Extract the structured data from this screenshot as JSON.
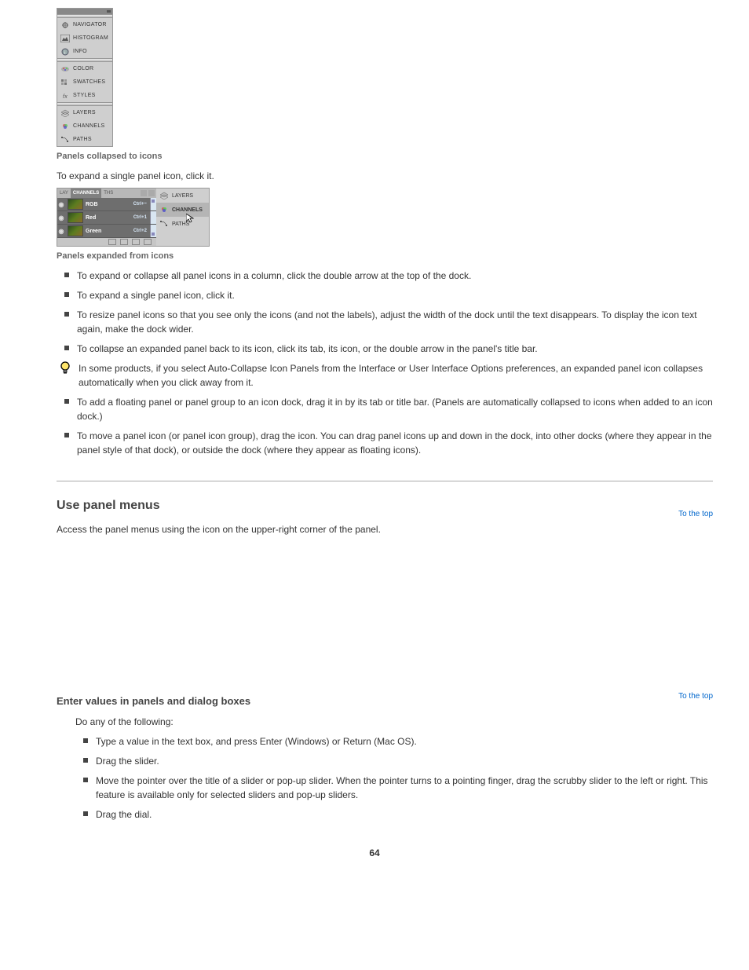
{
  "fig1": {
    "caption_label": "Panels collapsed to icons",
    "items": [
      {
        "label": "NAVIGATOR"
      },
      {
        "label": "HISTOGRAM"
      },
      {
        "label": "INFO"
      },
      {
        "label": "COLOR"
      },
      {
        "label": "SWATCHES"
      },
      {
        "label": "STYLES"
      },
      {
        "label": "LAYERS"
      },
      {
        "label": "CHANNELS"
      },
      {
        "label": "PATHS"
      }
    ]
  },
  "intro_text": "To expand a single panel icon, click it.",
  "fig2": {
    "tabs": {
      "t0": "LAY",
      "t1": "CHANNELS",
      "t2": "THS"
    },
    "channels": [
      {
        "name": "RGB",
        "shortcut": "Ctrl+~"
      },
      {
        "name": "Red",
        "shortcut": "Ctrl+1"
      },
      {
        "name": "Green",
        "shortcut": "Ctrl+2"
      }
    ],
    "right_items": [
      {
        "label": "LAYERS"
      },
      {
        "label": "CHANNELS"
      },
      {
        "label": "PATHS"
      }
    ],
    "caption_label": "Panels expanded from icons"
  },
  "bullets_a": [
    "To expand or collapse all panel icons in a column, click the double arrow at the top of the dock.",
    "To expand a single panel icon, click it.",
    "To resize panel icons so that you see only the icons (and not the labels), adjust the width of the dock until the text disappears. To display the icon text again, make the dock wider.",
    "To collapse an expanded panel back to its icon, click its tab, its icon, or the double arrow in the panel's title bar."
  ],
  "tip_text": "In some products, if you select Auto-Collapse Icon Panels from the Interface or User Interface Options preferences, an expanded panel icon collapses automatically when you click away from it.",
  "bullets_b": [
    "To add a floating panel or panel group to an icon dock, drag it in by its tab or title bar. (Panels are automatically collapsed to icons when added to an icon dock.)",
    "To move a panel icon (or panel icon group), drag the icon. You can drag panel icons up and down in the dock, into other docks (where they appear in the panel style of that dock), or outside the dock (where they appear as floating icons)."
  ],
  "to_top": "To the top",
  "section": {
    "title": "Use panel menus",
    "body": "Access the panel menus using the        icon on the upper-right corner of the panel."
  },
  "section2": {
    "title": "Enter values in panels and dialog boxes",
    "intro": "Do any of the following:",
    "items": [
      "Type a value in the text box, and press Enter (Windows) or Return (Mac OS).",
      "Drag the slider.",
      "Move the pointer over the title of a slider or pop-up slider. When the pointer turns to a pointing finger, drag the scrubby slider to the left or right. This feature is available only for selected sliders and pop-up sliders.",
      "Drag the dial."
    ]
  },
  "page_number": "64"
}
